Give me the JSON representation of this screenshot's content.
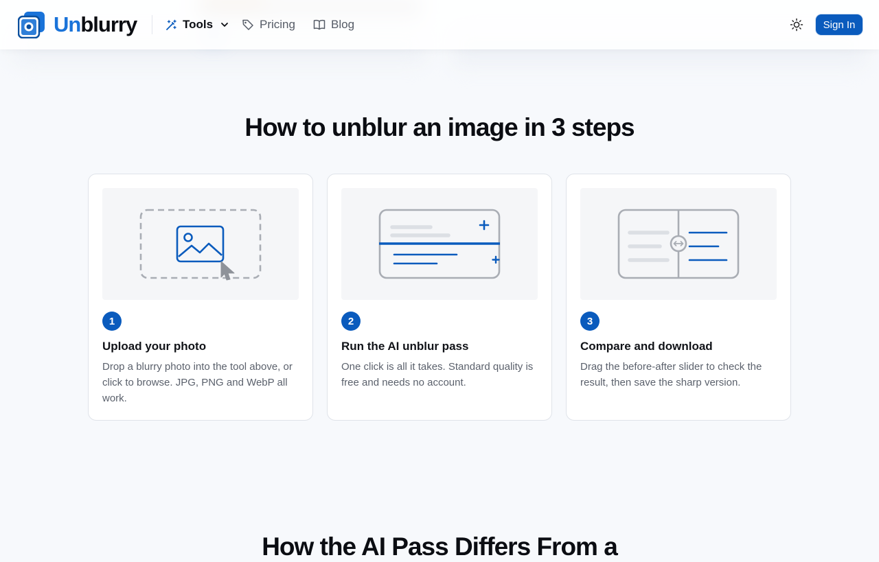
{
  "header": {
    "brand_part1": "Un",
    "brand_part2": "blurry",
    "nav": {
      "tools_label": "Tools",
      "pricing_label": "Pricing",
      "blog_label": "Blog"
    },
    "sign_in_label": "Sign In"
  },
  "how_to": {
    "title": "How to unblur an image in 3 steps",
    "steps": [
      {
        "number": "1",
        "title": "Upload your photo",
        "description": "Drop a blurry photo into the tool above, or click to browse. JPG, PNG and WebP all work."
      },
      {
        "number": "2",
        "title": "Run the AI unblur pass",
        "description": "One click is all it takes. Standard quality is free and needs no account."
      },
      {
        "number": "3",
        "title": "Compare and download",
        "description": "Drag the before-after slider to check the result, then save the sharp version."
      }
    ]
  },
  "next_section": {
    "title": "How the AI Pass Differs From a"
  },
  "colors": {
    "accent": "#0a5bbd",
    "brand_blue": "#1a73d9"
  },
  "icons": [
    "logo-icon",
    "wand-icon",
    "chevron-down-icon",
    "tag-icon",
    "book-icon",
    "sun-icon"
  ]
}
